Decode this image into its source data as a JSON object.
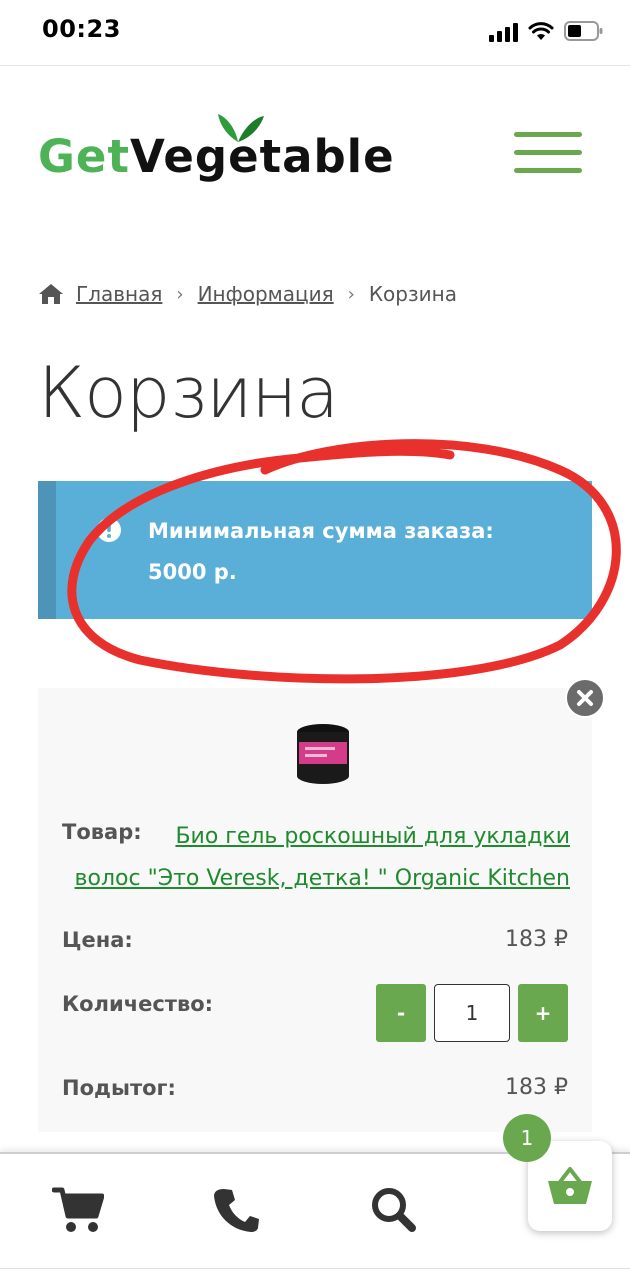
{
  "status_bar": {
    "time": "00:23"
  },
  "header": {
    "logo_part1": "Get",
    "logo_part2": "Vegetable",
    "brand_color": "#4db356",
    "accent_color": "#6aa84f"
  },
  "breadcrumb": {
    "items": [
      {
        "label": "Главная",
        "link": true
      },
      {
        "label": "Информация",
        "link": true
      },
      {
        "label": "Корзина",
        "link": false
      }
    ]
  },
  "page_title": "Корзина",
  "notice": {
    "line1": "Минимальная сумма заказа:",
    "line2": "5000 р.",
    "background": "#5aafd8"
  },
  "cart_item": {
    "product_label": "Товар:",
    "product_name_line1": "Био гель роскошный для укладки",
    "product_name_line2": "волос \"Это Veresk, детка! \" Organic Kitchen",
    "price_label": "Цена:",
    "price_value": "183 ₽",
    "quantity_label": "Количество:",
    "quantity_value": "1",
    "minus_label": "-",
    "plus_label": "+",
    "subtotal_label": "Подытог:",
    "subtotal_value": "183 ₽"
  },
  "bottom_bar": {
    "icons": [
      "cart-icon",
      "phone-icon",
      "search-icon"
    ],
    "cart_badge_count": "1"
  }
}
